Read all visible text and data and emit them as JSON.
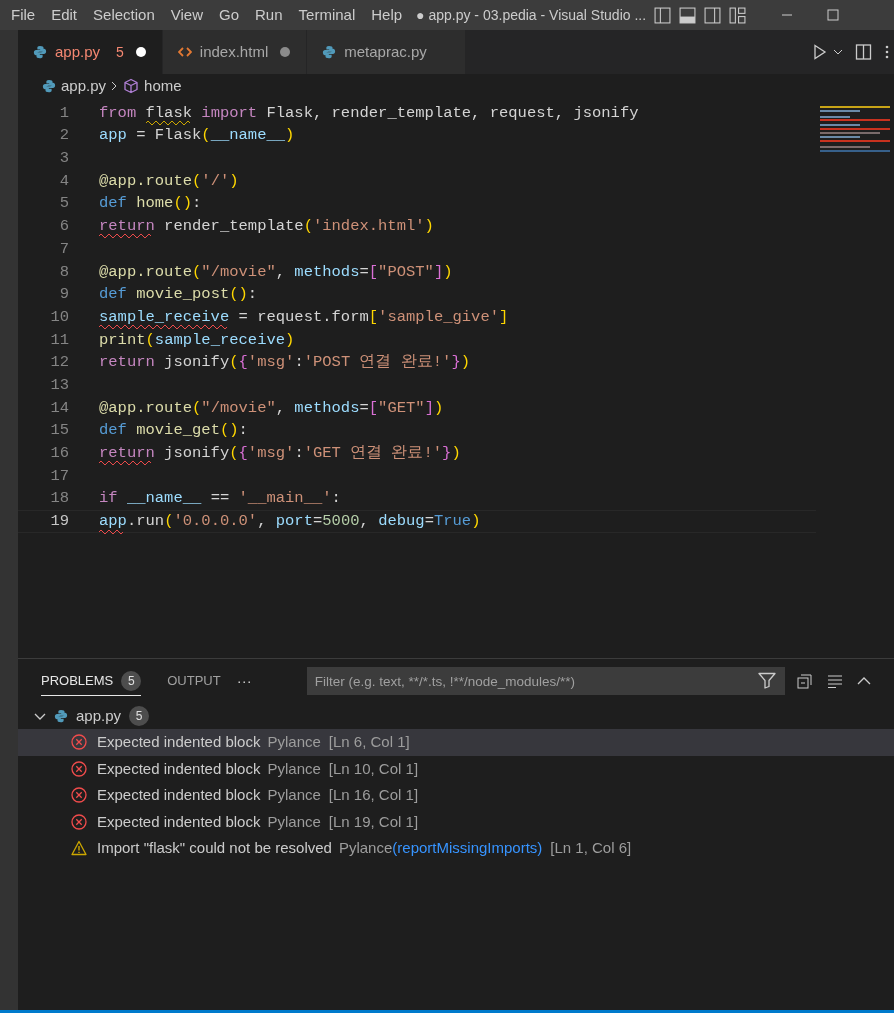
{
  "menu": [
    "File",
    "Edit",
    "Selection",
    "View",
    "Go",
    "Run",
    "Terminal",
    "Help"
  ],
  "window": {
    "title": "● app.py - 03.pedia - Visual Studio ..."
  },
  "tabs": [
    {
      "label": "app.py",
      "kind": "python",
      "problems": "5",
      "dirty": true,
      "selected": true
    },
    {
      "label": "index.html",
      "kind": "html",
      "dirty": true,
      "selected": false
    },
    {
      "label": "metaprac.py",
      "kind": "python",
      "dirty": false,
      "selected": false
    }
  ],
  "breadcrumb": {
    "file": "app.py",
    "symbol": "home"
  },
  "code": [
    {
      "number": "1",
      "current": false,
      "tokens": [
        {
          "text": "from ",
          "kind": "control"
        },
        {
          "text": "flask",
          "kind": "plain",
          "warning": true
        },
        {
          "text": " import",
          "kind": "control"
        },
        {
          "text": " Flask, render_template, request, jsonify"
        }
      ]
    },
    {
      "number": "2",
      "current": false,
      "tokens": [
        {
          "text": "app",
          "kind": "variable"
        },
        {
          "text": " = Flask"
        },
        {
          "text": "(",
          "kind": "bracket"
        },
        {
          "text": "__name__",
          "kind": "variable"
        },
        {
          "text": ")",
          "kind": "bracket"
        }
      ]
    },
    {
      "number": "3",
      "current": false
    },
    {
      "number": "4",
      "current": false,
      "tokens": [
        {
          "text": "@app.route",
          "kind": "function"
        },
        {
          "text": "(",
          "kind": "bracket"
        },
        {
          "text": "'/'",
          "kind": "string"
        },
        {
          "text": ")",
          "kind": "bracket"
        }
      ]
    },
    {
      "number": "5",
      "current": false,
      "tokens": [
        {
          "text": "def ",
          "kind": "keyword"
        },
        {
          "text": "home",
          "kind": "function"
        },
        {
          "text": "()",
          "kind": "bracket"
        },
        {
          "text": ":"
        }
      ]
    },
    {
      "number": "6",
      "current": false,
      "tokens": [
        {
          "text": "return",
          "kind": "control",
          "error": true
        },
        {
          "text": " render_template"
        },
        {
          "text": "(",
          "kind": "bracket"
        },
        {
          "text": "'index.html'",
          "kind": "string"
        },
        {
          "text": ")",
          "kind": "bracket"
        }
      ]
    },
    {
      "number": "7",
      "current": false
    },
    {
      "number": "8",
      "current": false,
      "tokens": [
        {
          "text": "@app.route",
          "kind": "function"
        },
        {
          "text": "(",
          "kind": "bracket"
        },
        {
          "text": "\"/movie\"",
          "kind": "string"
        },
        {
          "text": ", "
        },
        {
          "text": "methods",
          "kind": "variable"
        },
        {
          "text": "="
        },
        {
          "text": "[",
          "kind": "bracket2"
        },
        {
          "text": "\"POST\"",
          "kind": "string"
        },
        {
          "text": "]",
          "kind": "bracket2"
        },
        {
          "text": ")",
          "kind": "bracket"
        }
      ]
    },
    {
      "number": "9",
      "current": false,
      "tokens": [
        {
          "text": "def ",
          "kind": "keyword"
        },
        {
          "text": "movie_post",
          "kind": "function"
        },
        {
          "text": "()",
          "kind": "bracket"
        },
        {
          "text": ":"
        }
      ]
    },
    {
      "number": "10",
      "current": false,
      "tokens": [
        {
          "text": "sample_receive",
          "kind": "variable",
          "error": true
        },
        {
          "text": " = request.form"
        },
        {
          "text": "[",
          "kind": "bracket"
        },
        {
          "text": "'sample_give'",
          "kind": "string"
        },
        {
          "text": "]",
          "kind": "bracket"
        }
      ]
    },
    {
      "number": "11",
      "current": false,
      "tokens": [
        {
          "text": "print",
          "kind": "function"
        },
        {
          "text": "(",
          "kind": "bracket"
        },
        {
          "text": "sample_receive",
          "kind": "variable"
        },
        {
          "text": ")",
          "kind": "bracket"
        }
      ]
    },
    {
      "number": "12",
      "current": false,
      "tokens": [
        {
          "text": "return",
          "kind": "control"
        },
        {
          "text": " jsonify"
        },
        {
          "text": "(",
          "kind": "bracket"
        },
        {
          "text": "{",
          "kind": "bracket2"
        },
        {
          "text": "'msg'",
          "kind": "string"
        },
        {
          "text": ":"
        },
        {
          "text": "'POST 연결 완료!'",
          "kind": "string"
        },
        {
          "text": "}",
          "kind": "bracket2"
        },
        {
          "text": ")",
          "kind": "bracket"
        }
      ]
    },
    {
      "number": "13",
      "current": false
    },
    {
      "number": "14",
      "current": false,
      "tokens": [
        {
          "text": "@app.route",
          "kind": "function"
        },
        {
          "text": "(",
          "kind": "bracket"
        },
        {
          "text": "\"/movie\"",
          "kind": "string"
        },
        {
          "text": ", "
        },
        {
          "text": "methods",
          "kind": "variable"
        },
        {
          "text": "="
        },
        {
          "text": "[",
          "kind": "bracket2"
        },
        {
          "text": "\"GET\"",
          "kind": "string"
        },
        {
          "text": "]",
          "kind": "bracket2"
        },
        {
          "text": ")",
          "kind": "bracket"
        }
      ]
    },
    {
      "number": "15",
      "current": false,
      "tokens": [
        {
          "text": "def ",
          "kind": "keyword"
        },
        {
          "text": "movie_get",
          "kind": "function"
        },
        {
          "text": "()",
          "kind": "bracket"
        },
        {
          "text": ":"
        }
      ]
    },
    {
      "number": "16",
      "current": false,
      "tokens": [
        {
          "text": "return",
          "kind": "control",
          "error": true
        },
        {
          "text": " jsonify"
        },
        {
          "text": "(",
          "kind": "bracket"
        },
        {
          "text": "{",
          "kind": "bracket2"
        },
        {
          "text": "'msg'",
          "kind": "string"
        },
        {
          "text": ":"
        },
        {
          "text": "'GET 연결 완료!'",
          "kind": "string"
        },
        {
          "text": "}",
          "kind": "bracket2"
        },
        {
          "text": ")",
          "kind": "bracket"
        }
      ]
    },
    {
      "number": "17",
      "current": false
    },
    {
      "number": "18",
      "current": false,
      "tokens": [
        {
          "text": "if ",
          "kind": "control"
        },
        {
          "text": "__name__",
          "kind": "variable"
        },
        {
          "text": " == "
        },
        {
          "text": "'__main__'",
          "kind": "string"
        },
        {
          "text": ":"
        }
      ]
    },
    {
      "number": "19",
      "current": true,
      "tokens": [
        {
          "text": "app",
          "kind": "variable",
          "error": true
        },
        {
          "text": ".run"
        },
        {
          "text": "(",
          "kind": "bracket"
        },
        {
          "text": "'0.0.0.0'",
          "kind": "string"
        },
        {
          "text": ", "
        },
        {
          "text": "port",
          "kind": "variable"
        },
        {
          "text": "="
        },
        {
          "text": "5000",
          "kind": "number"
        },
        {
          "text": ", "
        },
        {
          "text": "debug",
          "kind": "variable"
        },
        {
          "text": "="
        },
        {
          "text": "True",
          "kind": "keyword"
        },
        {
          "text": ")",
          "kind": "bracket"
        }
      ]
    }
  ],
  "panel": {
    "tabs": [
      {
        "label": "PROBLEMS",
        "count": "5",
        "selected": true
      },
      {
        "label": "OUTPUT",
        "selected": false
      }
    ],
    "more": "···",
    "filter": {
      "placeholder": "Filter (e.g. text, **/*.ts, !**/node_modules/**)"
    },
    "file": {
      "name": "app.py",
      "count": "5",
      "expanded": true
    },
    "problems": [
      {
        "kind": "error",
        "message": "Expected indented block",
        "source": "Pylance",
        "location": "[Ln 6, Col 1]",
        "selected": true
      },
      {
        "kind": "error",
        "message": "Expected indented block",
        "source": "Pylance",
        "location": "[Ln 10, Col 1]",
        "selected": false
      },
      {
        "kind": "error",
        "message": "Expected indented block",
        "source": "Pylance",
        "location": "[Ln 16, Col 1]",
        "selected": false
      },
      {
        "kind": "error",
        "message": "Expected indented block",
        "source": "Pylance",
        "location": "[Ln 19, Col 1]",
        "selected": false
      },
      {
        "kind": "warning",
        "message": "Import \"flask\" could not be resolved",
        "source": "Pylance",
        "code": "(reportMissingImports)",
        "location": "[Ln 1, Col 6]",
        "selected": false
      }
    ]
  }
}
